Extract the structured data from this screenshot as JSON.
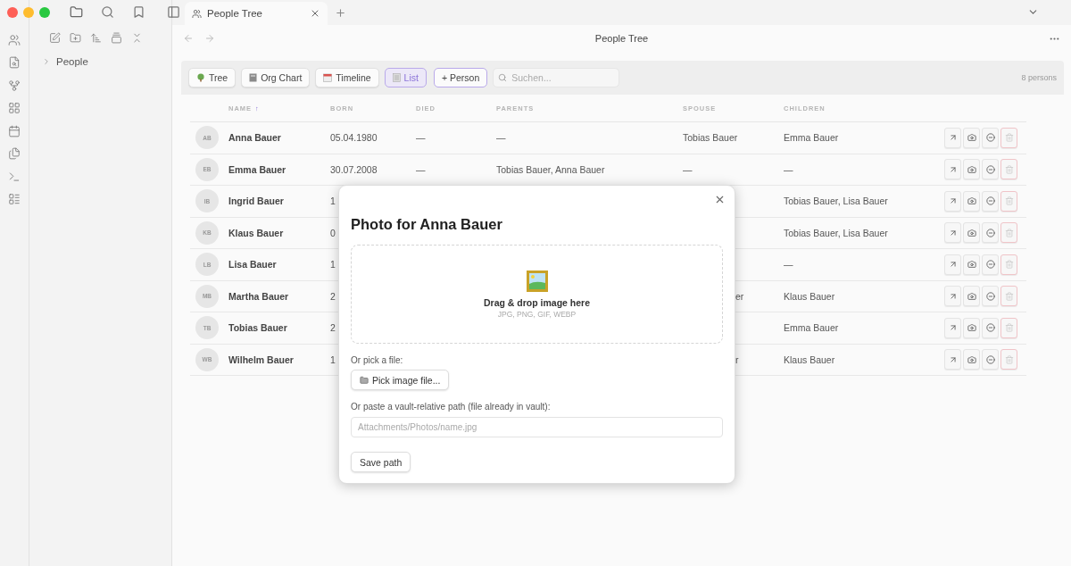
{
  "tab": {
    "title": "People Tree"
  },
  "sidebar": {
    "items": [
      {
        "label": "People",
        "expanded": false
      }
    ]
  },
  "header": {
    "title": "People Tree"
  },
  "views": [
    {
      "label": "Tree",
      "kind": "tree",
      "selected": false
    },
    {
      "label": "Org Chart",
      "kind": "org",
      "selected": false
    },
    {
      "label": "Timeline",
      "kind": "timeline",
      "selected": false
    },
    {
      "label": "List",
      "kind": "list",
      "selected": true
    }
  ],
  "add_button": "+ Person",
  "search": {
    "placeholder": "Suchen..."
  },
  "count": "8 persons",
  "table": {
    "columns": [
      {
        "label": "NAME",
        "sort": "↑"
      },
      {
        "label": "BORN"
      },
      {
        "label": "DIED"
      },
      {
        "label": "PARENTS"
      },
      {
        "label": "SPOUSE"
      },
      {
        "label": "CHILDREN"
      }
    ],
    "rows": [
      {
        "initials": "AB",
        "name": "Anna Bauer",
        "born": "05.04.1980",
        "died": "—",
        "parents": "—",
        "spouse": "Tobias Bauer",
        "children": "Emma Bauer"
      },
      {
        "initials": "EB",
        "name": "Emma Bauer",
        "born": "30.07.2008",
        "died": "—",
        "parents": "Tobias Bauer, Anna Bauer",
        "spouse": "—",
        "children": "—"
      },
      {
        "initials": "IB",
        "name": "Ingrid Bauer",
        "born": "1",
        "children": "Tobias Bauer, Lisa Bauer"
      },
      {
        "initials": "KB",
        "name": "Klaus Bauer",
        "born": "0",
        "children": "Tobias Bauer, Lisa Bauer"
      },
      {
        "initials": "LB",
        "name": "Lisa Bauer",
        "born": "1",
        "children": "—"
      },
      {
        "initials": "MB",
        "name": "Martha Bauer",
        "born": "2",
        "spouse_tail": "er",
        "children": "Klaus Bauer"
      },
      {
        "initials": "TB",
        "name": "Tobias Bauer",
        "born": "2",
        "children": "Emma Bauer"
      },
      {
        "initials": "WB",
        "name": "Wilhelm Bauer",
        "born": "1",
        "spouse_tail": "r",
        "children": "Klaus Bauer"
      }
    ]
  },
  "dialog": {
    "title": "Photo for Anna Bauer",
    "drop_title": "Drag & drop image here",
    "drop_hint": "JPG, PNG, GIF, WEBP",
    "pick_label": "Or pick a file:",
    "pick_button": "Pick image file...",
    "path_label": "Or paste a vault-relative path (file already in vault):",
    "path_field": {
      "placeholder": "Attachments/Photos/name.jpg"
    },
    "save_button": "Save path"
  }
}
